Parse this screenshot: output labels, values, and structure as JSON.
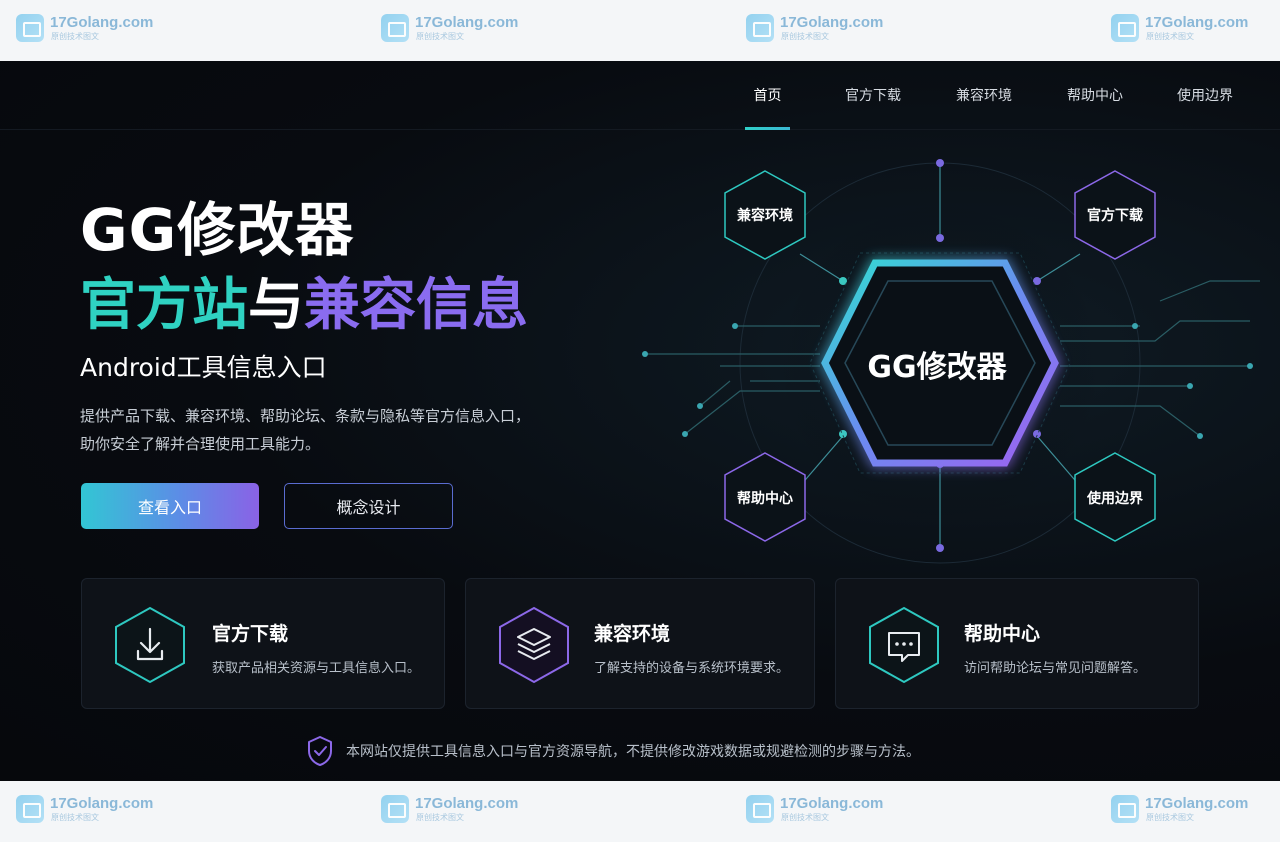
{
  "watermark": {
    "name": "17Golang.com",
    "sub": "原创技术图文"
  },
  "nav": {
    "items": [
      {
        "label": "首页",
        "active": true
      },
      {
        "label": "官方下载",
        "active": false
      },
      {
        "label": "兼容环境",
        "active": false
      },
      {
        "label": "帮助中心",
        "active": false
      },
      {
        "label": "使用边界",
        "active": false
      }
    ]
  },
  "hero": {
    "title": "GG修改器",
    "subtitle_part1": "官方站",
    "subtitle_part2": "与",
    "subtitle_part3": "兼容信息",
    "tagline": "Android工具信息入口",
    "description_line1": "提供产品下载、兼容环境、帮助论坛、条款与隐私等官方信息入口，",
    "description_line2": "助你安全了解并合理使用工具能力。",
    "primary_button": "查看入口",
    "secondary_button": "概念设计"
  },
  "diagram": {
    "center_label": "GG修改器",
    "nodes": {
      "top_left": "兼容环境",
      "top_right": "官方下载",
      "bottom_left": "帮助中心",
      "bottom_right": "使用边界"
    }
  },
  "cards": [
    {
      "title": "官方下载",
      "description": "获取产品相关资源与工具信息入口。",
      "icon": "download-icon"
    },
    {
      "title": "兼容环境",
      "description": "了解支持的设备与系统环境要求。",
      "icon": "layers-icon"
    },
    {
      "title": "帮助中心",
      "description": "访问帮助论坛与常见问题解答。",
      "icon": "chat-icon"
    }
  ],
  "disclaimer": {
    "text": "本网站仅提供工具信息入口与官方资源导航，不提供修改游戏数据或规避检测的步骤与方法。",
    "icon": "shield-check-icon"
  },
  "colors": {
    "accent_teal": "#2fd2c2",
    "accent_purple": "#8a6cf0",
    "background": "#080b10"
  }
}
